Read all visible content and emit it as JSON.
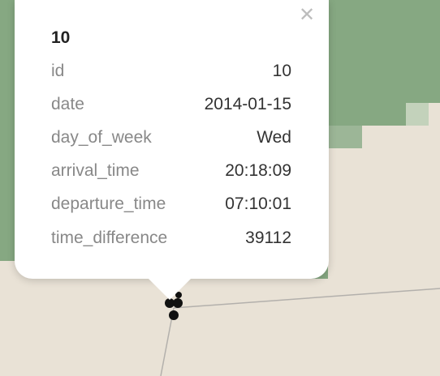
{
  "map": {
    "colors": {
      "land": "#e9e2d6",
      "forest": "#86a882",
      "forest_light": "#c3d2bb",
      "road": "#b3b0ac",
      "marker": "#111111"
    }
  },
  "popup": {
    "title": "10",
    "close_icon": "close-icon",
    "properties": [
      {
        "key": "id",
        "value": "10"
      },
      {
        "key": "date",
        "value": "2014-01-15"
      },
      {
        "key": "day_of_week",
        "value": "Wed"
      },
      {
        "key": "arrival_time",
        "value": "20:18:09"
      },
      {
        "key": "departure_time",
        "value": "07:10:01"
      },
      {
        "key": "time_difference",
        "value": "39112"
      }
    ]
  }
}
